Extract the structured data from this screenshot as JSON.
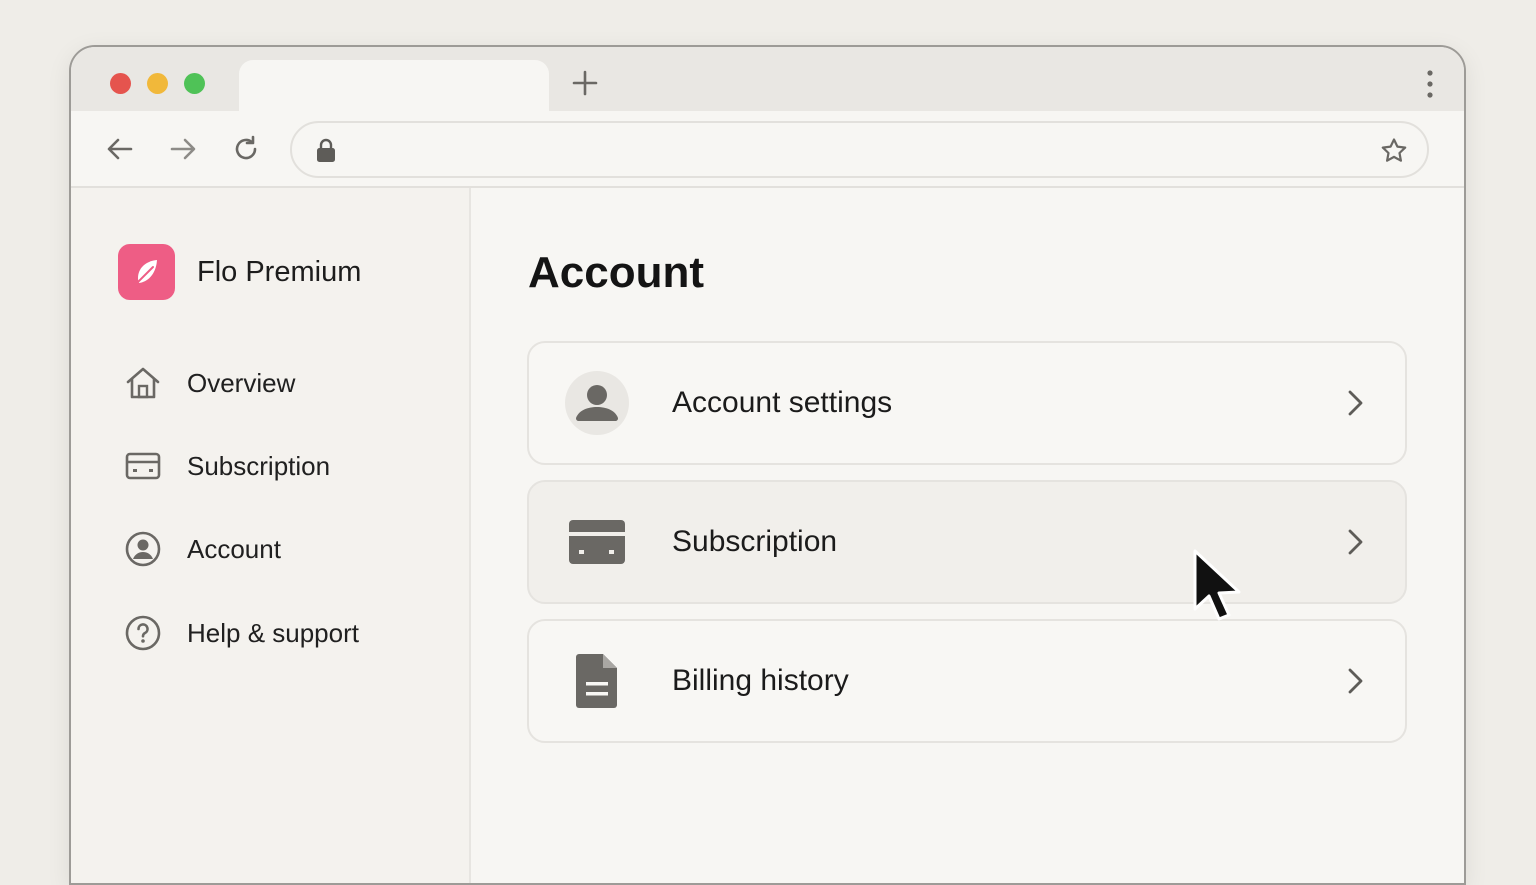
{
  "browser": {
    "tab_title": "",
    "address": "",
    "controls": {
      "back_icon": "arrow-left-icon",
      "forward_icon": "arrow-right-icon",
      "reload_icon": "reload-icon",
      "lock_icon": "lock-icon",
      "bookmark_icon": "star-icon",
      "new_tab_icon": "plus-icon",
      "menu_icon": "kebab-menu-icon"
    }
  },
  "sidebar": {
    "brand": {
      "name": "Flo Premium",
      "logo_icon": "feather-icon",
      "logo_color": "#ee5d85"
    },
    "items": [
      {
        "label": "Overview",
        "icon": "home-icon"
      },
      {
        "label": "Subscription",
        "icon": "card-icon"
      },
      {
        "label": "Account",
        "icon": "user-circle-icon"
      },
      {
        "label": "Help & support",
        "icon": "help-circle-icon"
      }
    ]
  },
  "main": {
    "title": "Account",
    "cards": [
      {
        "label": "Account settings",
        "icon": "user-avatar-icon"
      },
      {
        "label": "Subscription",
        "icon": "credit-card-icon"
      },
      {
        "label": "Billing history",
        "icon": "document-icon"
      }
    ]
  },
  "colors": {
    "accent": "#ee5d85",
    "traffic_red": "#e5544e",
    "traffic_yellow": "#f1b83a",
    "traffic_green": "#4fc257"
  }
}
